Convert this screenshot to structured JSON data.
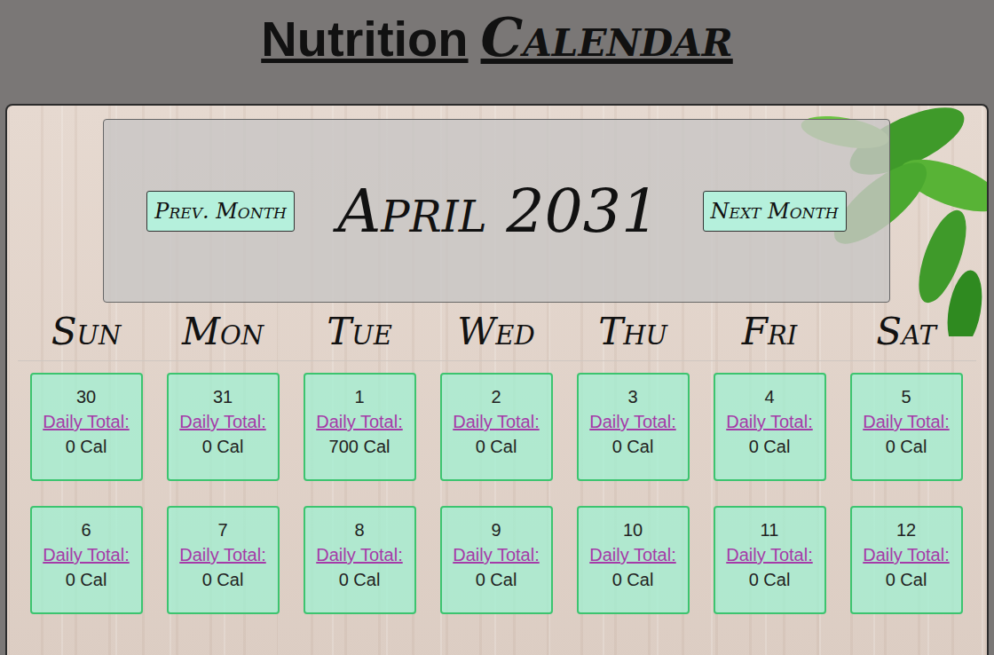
{
  "header": {
    "title_bold": "Nutrition",
    "title_script": "Calendar"
  },
  "month_bar": {
    "prev_button": "Prev. Month",
    "month": "April 2031",
    "next_button": "Next Month"
  },
  "weekdays": [
    "Sun",
    "Mon",
    "Tue",
    "Wed",
    "Thu",
    "Fri",
    "Sat"
  ],
  "days": [
    {
      "day": "30",
      "label": "Daily Total:",
      "total": "0 Cal"
    },
    {
      "day": "31",
      "label": "Daily Total:",
      "total": "0 Cal"
    },
    {
      "day": "1",
      "label": "Daily Total:",
      "total": "700 Cal"
    },
    {
      "day": "2",
      "label": "Daily Total:",
      "total": "0 Cal"
    },
    {
      "day": "3",
      "label": "Daily Total:",
      "total": "0 Cal"
    },
    {
      "day": "4",
      "label": "Daily Total:",
      "total": "0 Cal"
    },
    {
      "day": "5",
      "label": "Daily Total:",
      "total": "0 Cal"
    },
    {
      "day": "6",
      "label": "Daily Total:",
      "total": "0 Cal"
    },
    {
      "day": "7",
      "label": "Daily Total:",
      "total": "0 Cal"
    },
    {
      "day": "8",
      "label": "Daily Total:",
      "total": "0 Cal"
    },
    {
      "day": "9",
      "label": "Daily Total:",
      "total": "0 Cal"
    },
    {
      "day": "10",
      "label": "Daily Total:",
      "total": "0 Cal"
    },
    {
      "day": "11",
      "label": "Daily Total:",
      "total": "0 Cal"
    },
    {
      "day": "12",
      "label": "Daily Total:",
      "total": "0 Cal"
    }
  ]
}
